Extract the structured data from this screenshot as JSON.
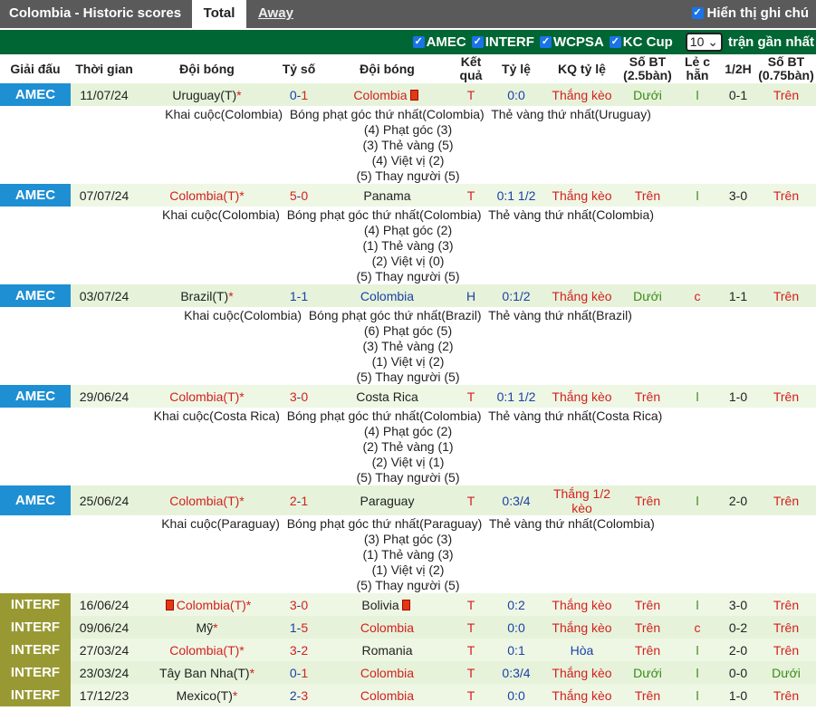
{
  "header": {
    "title": "Colombia - Historic scores",
    "tab_total": "Total",
    "tab_away": "Away",
    "show_notes": "Hiển thị ghi chú"
  },
  "filters": {
    "items": [
      "AMEC",
      "INTERF",
      "WCPSA",
      "KC Cup"
    ],
    "count": "10",
    "count_suffix": "trận gần nhất"
  },
  "columns": [
    "Giải đấu",
    "Thời gian",
    "Đội bóng",
    "Tỷ số",
    "Đội bóng",
    "Kết quả",
    "Tỷ lệ",
    "KQ tỷ lệ",
    "Số BT (2.5bàn)",
    "Lẻ c hẵn",
    "1/2H",
    "Số BT (0.75bàn)"
  ],
  "league_colors": {
    "AMEC": "#1e8fd2",
    "INTERF": "#999933"
  },
  "matches": [
    {
      "league": "AMEC",
      "date": "11/07/24",
      "home": "Uruguay(T)",
      "home_star": "*",
      "home_color": "dark",
      "score_h": "0",
      "score_a": "1",
      "sh_color": "blue",
      "sa_color": "red",
      "away": "Colombia",
      "away_color": "red",
      "away_flag": true,
      "result": "T",
      "odds": "0:0",
      "odds_result": "Thắng kèo",
      "bt": "Dưới",
      "bt_color": "green",
      "oe": "l",
      "oe_color": "green",
      "half": "0-1",
      "bt2": "Trên",
      "bt2_color": "red",
      "details": [
        "Khai cuộc(Colombia)  Bóng phạt góc thứ nhất(Colombia)  Thẻ vàng thứ nhất(Uruguay)",
        "(4) Phạt góc (3)",
        "(3) Thẻ vàng (5)",
        "(4) Việt vị (2)",
        "(5) Thay người (5)"
      ]
    },
    {
      "league": "AMEC",
      "date": "07/07/24",
      "home": "Colombia(T)",
      "home_star": "*",
      "home_color": "red",
      "score_h": "5",
      "score_a": "0",
      "sh_color": "red",
      "sa_color": "red",
      "away": "Panama",
      "away_color": "dark",
      "result": "T",
      "odds": "0:1 1/2",
      "odds_result": "Thắng kèo",
      "bt": "Trên",
      "bt_color": "red",
      "oe": "l",
      "oe_color": "green",
      "half": "3-0",
      "bt2": "Trên",
      "bt2_color": "red",
      "details": [
        "Khai cuộc(Colombia)  Bóng phạt góc thứ nhất(Colombia)  Thẻ vàng thứ nhất(Colombia)",
        "(4) Phạt góc (2)",
        "(1) Thẻ vàng (3)",
        "(2) Việt vị (0)",
        "(5) Thay người (5)"
      ]
    },
    {
      "league": "AMEC",
      "date": "03/07/24",
      "home": "Brazil(T)",
      "home_star": "*",
      "home_color": "dark",
      "score_h": "1",
      "score_a": "1",
      "sh_color": "blue",
      "sa_color": "blue",
      "away": "Colombia",
      "away_color": "blue",
      "result": "H",
      "odds": "0:1/2",
      "odds_result": "Thắng kèo",
      "bt": "Dưới",
      "bt_color": "green",
      "oe": "c",
      "oe_color": "red",
      "half": "1-1",
      "bt2": "Trên",
      "bt2_color": "red",
      "details": [
        "Khai cuộc(Colombia)  Bóng phạt góc thứ nhất(Brazil)  Thẻ vàng thứ nhất(Brazil)",
        "(6) Phạt góc (5)",
        "(3) Thẻ vàng (2)",
        "(1) Việt vị (2)",
        "(5) Thay người (5)"
      ]
    },
    {
      "league": "AMEC",
      "date": "29/06/24",
      "home": "Colombia(T)",
      "home_star": "*",
      "home_color": "red",
      "score_h": "3",
      "score_a": "0",
      "sh_color": "red",
      "sa_color": "red",
      "away": "Costa Rica",
      "away_color": "dark",
      "result": "T",
      "odds": "0:1 1/2",
      "odds_result": "Thắng kèo",
      "bt": "Trên",
      "bt_color": "red",
      "oe": "l",
      "oe_color": "green",
      "half": "1-0",
      "bt2": "Trên",
      "bt2_color": "red",
      "details": [
        "Khai cuộc(Costa Rica)  Bóng phạt góc thứ nhất(Colombia)  Thẻ vàng thứ nhất(Costa Rica)",
        "(4) Phạt góc (2)",
        "(2) Thẻ vàng (1)",
        "(2) Việt vị (1)",
        "(5) Thay người (5)"
      ]
    },
    {
      "league": "AMEC",
      "date": "25/06/24",
      "home": "Colombia(T)",
      "home_star": "*",
      "home_color": "red",
      "score_h": "2",
      "score_a": "1",
      "sh_color": "red",
      "sa_color": "red",
      "away": "Paraguay",
      "away_color": "dark",
      "result": "T",
      "odds": "0:3/4",
      "odds_result": "Thắng 1/2 kèo",
      "bt": "Trên",
      "bt_color": "red",
      "oe": "l",
      "oe_color": "green",
      "half": "2-0",
      "bt2": "Trên",
      "bt2_color": "red",
      "tall": true,
      "details": [
        "Khai cuộc(Paraguay)  Bóng phạt góc thứ nhất(Paraguay)  Thẻ vàng thứ nhất(Colombia)",
        "(3) Phạt góc (3)",
        "(1) Thẻ vàng (3)",
        "(1) Việt vị (2)",
        "(5) Thay người (5)"
      ]
    },
    {
      "league": "INTERF",
      "date": "16/06/24",
      "home": "Colombia(T)",
      "home_star": "*",
      "home_flag": true,
      "home_color": "red",
      "score_h": "3",
      "score_a": "0",
      "sh_color": "red",
      "sa_color": "red",
      "away": "Bolivia",
      "away_color": "dark",
      "away_flag": true,
      "result": "T",
      "odds": "0:2",
      "odds_result": "Thắng kèo",
      "bt": "Trên",
      "bt_color": "red",
      "oe": "l",
      "oe_color": "green",
      "half": "3-0",
      "bt2": "Trên",
      "bt2_color": "red"
    },
    {
      "league": "INTERF",
      "date": "09/06/24",
      "home": "Mỹ",
      "home_star": "*",
      "home_color": "dark",
      "score_h": "1",
      "score_a": "5",
      "sh_color": "blue",
      "sa_color": "red",
      "away": "Colombia",
      "away_color": "red",
      "result": "T",
      "odds": "0:0",
      "odds_result": "Thắng kèo",
      "bt": "Trên",
      "bt_color": "red",
      "oe": "c",
      "oe_color": "red",
      "half": "0-2",
      "bt2": "Trên",
      "bt2_color": "red"
    },
    {
      "league": "INTERF",
      "date": "27/03/24",
      "home": "Colombia(T)",
      "home_star": "*",
      "home_color": "red",
      "score_h": "3",
      "score_a": "2",
      "sh_color": "red",
      "sa_color": "red",
      "away": "Romania",
      "away_color": "dark",
      "result": "T",
      "odds": "0:1",
      "odds_result": "Hòa",
      "or_color": "blue",
      "bt": "Trên",
      "bt_color": "red",
      "oe": "l",
      "oe_color": "green",
      "half": "2-0",
      "bt2": "Trên",
      "bt2_color": "red"
    },
    {
      "league": "INTERF",
      "date": "23/03/24",
      "home": "Tây Ban Nha(T)",
      "home_star": "*",
      "home_color": "dark",
      "score_h": "0",
      "score_a": "1",
      "sh_color": "blue",
      "sa_color": "red",
      "away": "Colombia",
      "away_color": "red",
      "result": "T",
      "odds": "0:3/4",
      "odds_result": "Thắng kèo",
      "bt": "Dưới",
      "bt_color": "green",
      "oe": "l",
      "oe_color": "green",
      "half": "0-0",
      "bt2": "Dưới",
      "bt2_color": "green"
    },
    {
      "league": "INTERF",
      "date": "17/12/23",
      "home": "Mexico(T)",
      "home_star": "*",
      "home_color": "dark",
      "score_h": "2",
      "score_a": "3",
      "sh_color": "blue",
      "sa_color": "red",
      "away": "Colombia",
      "away_color": "red",
      "result": "T",
      "odds": "0:0",
      "odds_result": "Thắng kèo",
      "bt": "Trên",
      "bt_color": "red",
      "oe": "l",
      "oe_color": "green",
      "half": "1-0",
      "bt2": "Trên",
      "bt2_color": "red"
    }
  ]
}
